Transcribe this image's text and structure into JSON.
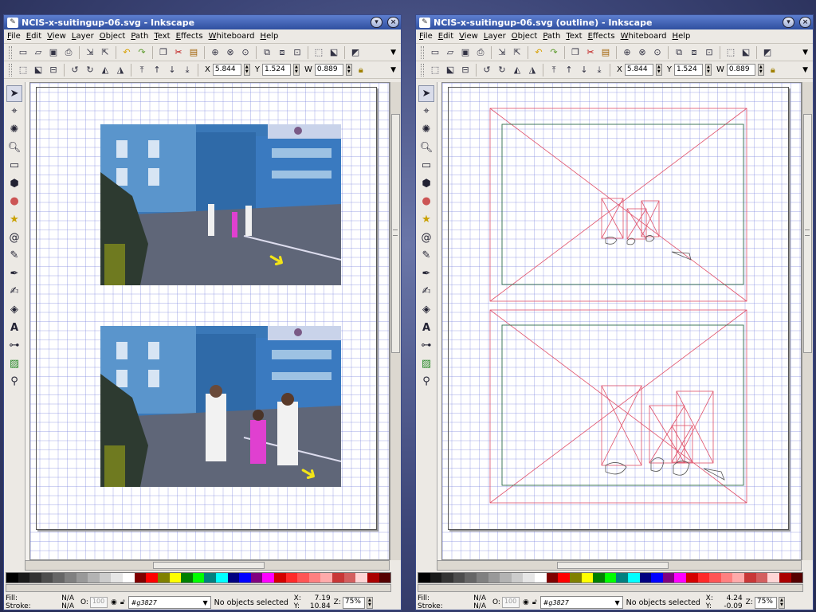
{
  "left": {
    "title": "NCIS-x-suitingup-06.svg - Inkscape",
    "status_message": "No objects selected",
    "coord_x": "7.19",
    "coord_y": "10.84"
  },
  "right": {
    "title": "NCIS-x-suitingup-06.svg (outline) - Inkscape",
    "status_message": "No objects selected",
    "coord_x": "4.24",
    "coord_y": "-0.09"
  },
  "menu": [
    "File",
    "Edit",
    "View",
    "Layer",
    "Object",
    "Path",
    "Text",
    "Effects",
    "Whiteboard",
    "Help"
  ],
  "fields": {
    "x_label": "X",
    "x": "5.844",
    "y_label": "Y",
    "y": "1.524",
    "w_label": "W",
    "w": "0.889"
  },
  "status": {
    "fill_label": "Fill:",
    "fill": "N/A",
    "stroke_label": "Stroke:",
    "stroke": "N/A",
    "opacity_label": "O:",
    "opacity": "100",
    "layer": "#g3827",
    "x_label": "X:",
    "y_label": "Y:",
    "z_label": "Z:",
    "zoom": "75%"
  },
  "icons": {
    "close": "×",
    "shade": "▾",
    "more": "▼"
  },
  "palette": [
    "#000000",
    "#1a1a1a",
    "#333333",
    "#4d4d4d",
    "#666666",
    "#808080",
    "#999999",
    "#b3b3b3",
    "#cccccc",
    "#e6e6e6",
    "#ffffff",
    "#800000",
    "#ff0000",
    "#808000",
    "#ffff00",
    "#008000",
    "#00ff00",
    "#008080",
    "#00ffff",
    "#000080",
    "#0000ff",
    "#800080",
    "#ff00ff",
    "#d40000",
    "#ff2a2a",
    "#ff5555",
    "#ff8080",
    "#ffaaaa",
    "#c83737",
    "#d35f5f",
    "#ffd5d5",
    "#aa0000",
    "#550000"
  ]
}
